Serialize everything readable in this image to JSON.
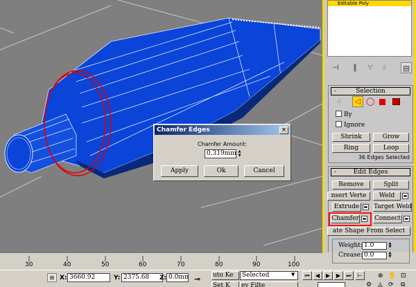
{
  "modifier_stack": {
    "selected_item": "Editable Poly"
  },
  "selection_rollout": {
    "title": "Selection",
    "by_vertex_label": "By",
    "ignore_backfacing_label": "Ignore",
    "shrink_label": "Shrink",
    "grow_label": "Grow",
    "ring_label": "Ring",
    "loop_label": "Loop",
    "status": "36 Edges Selected"
  },
  "edit_edges_rollout": {
    "title": "Edit Edges",
    "remove_label": "Remove",
    "split_label": "Split",
    "insert_vertex_label": "nsert Verte",
    "weld_label": "Weld",
    "extrude_label": "Extrude",
    "target_weld_label": "Target Weld",
    "chamfer_label": "Chamfer",
    "connect_label": "Connect",
    "create_shape_label": "ate Shape From Select",
    "weight_label": "Weight:",
    "weight_value": "1.0",
    "crease_label": "Crease:",
    "crease_value": "0.0"
  },
  "dialog": {
    "title": "Chamfer Edges",
    "close_glyph": "×",
    "amount_label": "Chamfer Amount:",
    "amount_value": "0.319mm",
    "apply_label": "Apply",
    "ok_label": "Ok",
    "cancel_label": "Cancel"
  },
  "timeline": {
    "ticks": [
      "30",
      "40",
      "50",
      "60",
      "70",
      "80",
      "90",
      "100"
    ]
  },
  "statusbar": {
    "x_label": "X:",
    "x_value": "3660.92",
    "y_label": "Y:",
    "y_value": "2375.68",
    "z_label": "Z:",
    "z_value": "0.0mm",
    "auto_key_label": "uto Ke",
    "set_key_label": "Set K",
    "selected_value": "Selected",
    "key_filters_label": "ey Filte"
  },
  "colors": {
    "viewport_bg": "#7f7f7f",
    "mesh_blue": "#0a44d8",
    "selected_edge": "#e00000",
    "highlight": "#ff1010",
    "panel_border": "#ffd800"
  }
}
